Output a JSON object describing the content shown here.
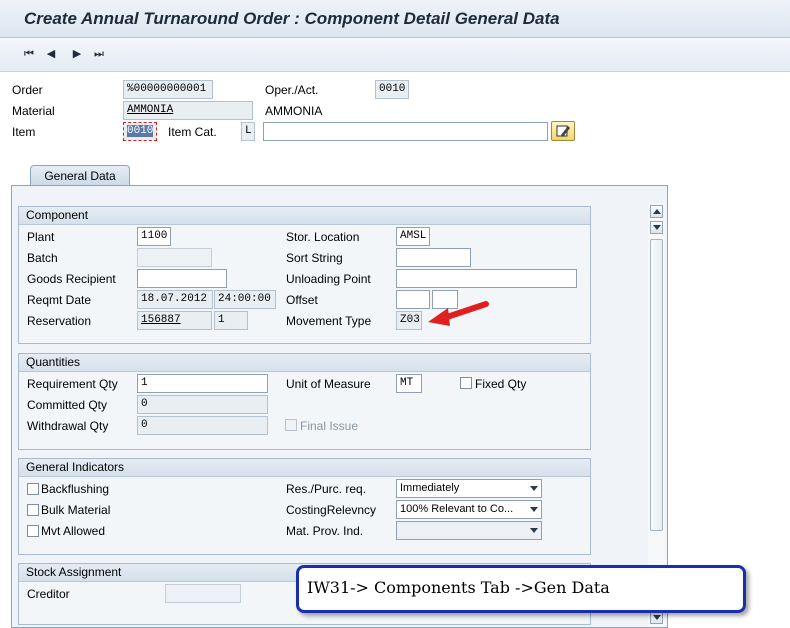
{
  "window": {
    "title": "Create Annual Turnaround Order : Component Detail General Data"
  },
  "toolbar": {
    "first": "⏮",
    "prev": "◀",
    "next": "▶",
    "last": "⏭"
  },
  "header": {
    "order_label": "Order",
    "order_value": "%00000000001",
    "operact_label": "Oper./Act.",
    "operact_value": "0010",
    "material_label": "Material",
    "material_value": "AMMONIA",
    "material_desc": "AMMONIA",
    "item_label": "Item",
    "item_value": "0010",
    "itemcat_label": "Item Cat.",
    "itemcat_value": "L",
    "text_value": ""
  },
  "tabs": [
    {
      "label": "General Data"
    }
  ],
  "component": {
    "title": "Component",
    "plant_label": "Plant",
    "plant_value": "1100",
    "batch_label": "Batch",
    "batch_value": "",
    "goods_label": "Goods Recipient",
    "goods_value": "",
    "reqmt_label": "Reqmt Date",
    "reqmt_date": "18.07.2012",
    "reqmt_time": "24:00:00",
    "reservation_label": "Reservation",
    "reservation_value": "156887",
    "reservation_item": "1",
    "stor_label": "Stor. Location",
    "stor_value": "AMSL",
    "sort_label": "Sort String",
    "sort_value": "",
    "unloading_label": "Unloading Point",
    "unloading_value": "",
    "offset_label": "Offset",
    "offset_value": "",
    "offset_unit": "",
    "movement_label": "Movement Type",
    "movement_value": "Z03"
  },
  "quantities": {
    "title": "Quantities",
    "req_label": "Requirement Qty",
    "req_value": "1",
    "committed_label": "Committed Qty",
    "committed_value": "0",
    "withdrawal_label": "Withdrawal Qty",
    "withdrawal_value": "0",
    "uom_label": "Unit of Measure",
    "uom_value": "MT",
    "fixed_label": "Fixed Qty",
    "final_label": "Final Issue"
  },
  "indicators": {
    "title": "General Indicators",
    "backflush_label": "Backflushing",
    "bulk_label": "Bulk Material",
    "mvt_label": "Mvt Allowed",
    "respurc_label": "Res./Purc. req.",
    "respurc_value": "Immediately",
    "costing_label": "CostingRelevncy",
    "costing_value": "100% Relevant to Co...",
    "matprov_label": "Mat. Prov. Ind.",
    "matprov_value": ""
  },
  "stock": {
    "title": "Stock Assignment",
    "creditor_label": "Creditor",
    "creditor_value": ""
  },
  "annotation": {
    "text": "IW31-> Components Tab ->Gen Data",
    "arrow_color": "#e02020",
    "box_color": "#1a2fb0"
  }
}
